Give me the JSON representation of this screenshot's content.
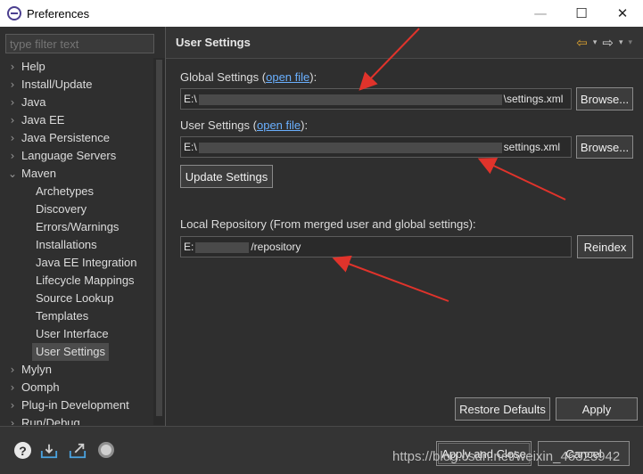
{
  "window": {
    "title": "Preferences",
    "minimize": "—",
    "maximize": "☐",
    "close": "✕"
  },
  "filter": {
    "placeholder": "type filter text"
  },
  "tree": [
    {
      "label": "Help",
      "level": 0,
      "chevron": "›"
    },
    {
      "label": "Install/Update",
      "level": 0,
      "chevron": "›"
    },
    {
      "label": "Java",
      "level": 0,
      "chevron": "›"
    },
    {
      "label": "Java EE",
      "level": 0,
      "chevron": "›"
    },
    {
      "label": "Java Persistence",
      "level": 0,
      "chevron": "›"
    },
    {
      "label": "Language Servers",
      "level": 0,
      "chevron": "›"
    },
    {
      "label": "Maven",
      "level": 0,
      "chevron": "⌄"
    },
    {
      "label": "Archetypes",
      "level": 1
    },
    {
      "label": "Discovery",
      "level": 1
    },
    {
      "label": "Errors/Warnings",
      "level": 1
    },
    {
      "label": "Installations",
      "level": 1
    },
    {
      "label": "Java EE Integration",
      "level": 1
    },
    {
      "label": "Lifecycle Mappings",
      "level": 1
    },
    {
      "label": "Source Lookup",
      "level": 1
    },
    {
      "label": "Templates",
      "level": 1
    },
    {
      "label": "User Interface",
      "level": 1
    },
    {
      "label": "User Settings",
      "level": 1,
      "selected": true
    },
    {
      "label": "Mylyn",
      "level": 0,
      "chevron": "›"
    },
    {
      "label": "Oomph",
      "level": 0,
      "chevron": "›"
    },
    {
      "label": "Plug-in Development",
      "level": 0,
      "chevron": "›"
    },
    {
      "label": "Run/Debug",
      "level": 0,
      "chevron": "›"
    }
  ],
  "page": {
    "title": "User Settings",
    "nav": {
      "back": "⇦",
      "forward": "⇨",
      "dropdown": "▾",
      "menu": "▾"
    },
    "global": {
      "label_prefix": "Global Settings (",
      "link": "open file",
      "label_suffix": "):",
      "value_start": "E:\\",
      "value_end": "\\settings.xml",
      "browse": "Browse..."
    },
    "user": {
      "label_prefix": "User Settings (",
      "link": "open file",
      "label_suffix": "):",
      "value_start": "E:\\",
      "value_end": "settings.xml",
      "browse": "Browse..."
    },
    "update_button": "Update Settings",
    "local_repo": {
      "label": "Local Repository (From merged user and global settings):",
      "value_start": "E:",
      "value_end": "/repository",
      "reindex": "Reindex"
    },
    "restore_defaults": "Restore Defaults",
    "apply": "Apply"
  },
  "footer": {
    "help": "?",
    "apply_and_close": "Apply and Close",
    "cancel": "Cancel",
    "watermark": "https://blog.csdn.net/weixin_46325942"
  },
  "colors": {
    "background": "#2f2f2f",
    "link": "#6ab0ff",
    "annotation_arrow": "#e0332b",
    "back_arrow": "#d9a030"
  }
}
